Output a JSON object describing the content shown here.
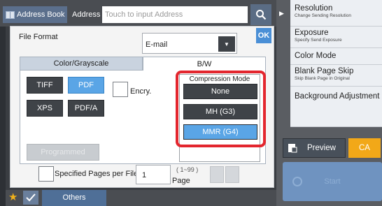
{
  "topbar": {
    "address_book": "Address Book",
    "address_label": "Address",
    "address_placeholder": "Touch to input Address",
    "search_icon": "search-icon"
  },
  "dialog": {
    "file_format_label": "File Format",
    "file_format_value": "E-mail",
    "ok_label": "OK",
    "tabs": [
      "Color/Grayscale",
      "B/W"
    ],
    "active_tab": "B/W",
    "formats": [
      "TIFF",
      "PDF",
      "XPS",
      "PDF/A"
    ],
    "selected_format": "PDF",
    "encryption_label": "Encry.",
    "programmed_label": "Programmed",
    "compression": {
      "title": "Compression Mode",
      "options": [
        "None",
        "MH (G3)",
        "MMR (G4)"
      ],
      "selected": "MMR (G4)"
    },
    "specified_pages_label": "Specified Pages per File",
    "pages_value": "1",
    "pages_range": "( 1~99 )",
    "pages_unit": "Page"
  },
  "right_menu": [
    {
      "main": "Resolution",
      "sub": "Change Sending Resolution"
    },
    {
      "main": "Exposure",
      "sub": "Specify Send Exposure"
    },
    {
      "main": "Color Mode",
      "sub": ""
    },
    {
      "main": "Blank Page Skip",
      "sub": "Skip Blank Page in Original"
    },
    {
      "main": "Background Adjustment",
      "sub": ""
    }
  ],
  "actions": {
    "preview": "Preview",
    "ca": "CA",
    "start": "Start"
  },
  "bottombar": {
    "others": "Others"
  },
  "colors": {
    "accent_blue": "#5aa5e6",
    "highlight_red": "#e3262e",
    "ca_orange": "#f2a818"
  }
}
